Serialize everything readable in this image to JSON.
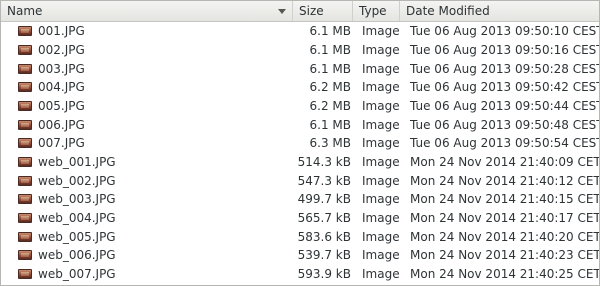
{
  "columns": {
    "name": "Name",
    "size": "Size",
    "type": "Type",
    "date": "Date Modified"
  },
  "files": [
    {
      "name": "001.JPG",
      "size": "6.1 MB",
      "type": "Image",
      "date": "Tue 06 Aug 2013 09:50:10 CEST"
    },
    {
      "name": "002.JPG",
      "size": "6.1 MB",
      "type": "Image",
      "date": "Tue 06 Aug 2013 09:50:16 CEST"
    },
    {
      "name": "003.JPG",
      "size": "6.1 MB",
      "type": "Image",
      "date": "Tue 06 Aug 2013 09:50:28 CEST"
    },
    {
      "name": "004.JPG",
      "size": "6.2 MB",
      "type": "Image",
      "date": "Tue 06 Aug 2013 09:50:42 CEST"
    },
    {
      "name": "005.JPG",
      "size": "6.2 MB",
      "type": "Image",
      "date": "Tue 06 Aug 2013 09:50:44 CEST"
    },
    {
      "name": "006.JPG",
      "size": "6.1 MB",
      "type": "Image",
      "date": "Tue 06 Aug 2013 09:50:48 CEST"
    },
    {
      "name": "007.JPG",
      "size": "6.3 MB",
      "type": "Image",
      "date": "Tue 06 Aug 2013 09:50:54 CEST"
    },
    {
      "name": "web_001.JPG",
      "size": "514.3 kB",
      "type": "Image",
      "date": "Mon 24 Nov 2014 21:40:09 CET"
    },
    {
      "name": "web_002.JPG",
      "size": "547.3 kB",
      "type": "Image",
      "date": "Mon 24 Nov 2014 21:40:12 CET"
    },
    {
      "name": "web_003.JPG",
      "size": "499.7 kB",
      "type": "Image",
      "date": "Mon 24 Nov 2014 21:40:15 CET"
    },
    {
      "name": "web_004.JPG",
      "size": "565.7 kB",
      "type": "Image",
      "date": "Mon 24 Nov 2014 21:40:17 CET"
    },
    {
      "name": "web_005.JPG",
      "size": "583.6 kB",
      "type": "Image",
      "date": "Mon 24 Nov 2014 21:40:20 CET"
    },
    {
      "name": "web_006.JPG",
      "size": "539.7 kB",
      "type": "Image",
      "date": "Mon 24 Nov 2014 21:40:23 CET"
    },
    {
      "name": "web_007.JPG",
      "size": "593.9 kB",
      "type": "Image",
      "date": "Mon 24 Nov 2014 21:40:25 CET"
    }
  ],
  "icons": {
    "file": "image-file-icon",
    "sort": "sort-descending-icon"
  }
}
